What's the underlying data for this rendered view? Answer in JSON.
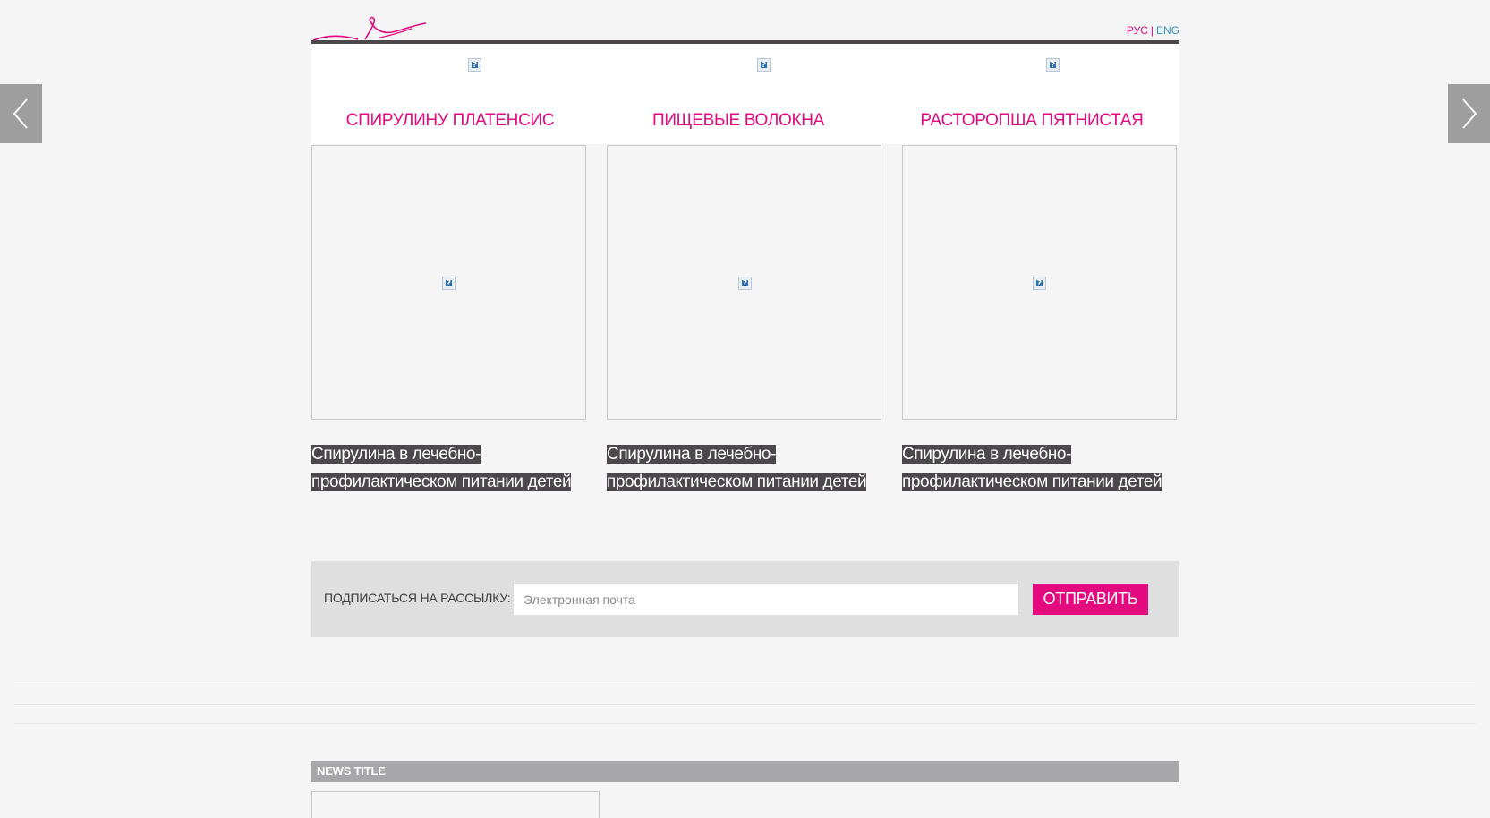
{
  "header": {
    "lang_ru": "РУС",
    "lang_separator": "|",
    "lang_en": "ENG",
    "accent_color": "#e5097f",
    "bar_color": "#4b474a",
    "logo_icon": "flamingo-logo-icon"
  },
  "carousel": {
    "prev_icon": "chevron-left-icon",
    "next_icon": "chevron-right-icon",
    "items": [
      {
        "title": "СПИРУЛИНУ ПЛАТЕНСИС",
        "caption": "Спирулина в лечебно-профилактическом питании детей",
        "icon_image": "broken-image-icon",
        "thumb_image": "broken-image-icon"
      },
      {
        "title": "ПИЩЕВЫЕ ВОЛОКНА",
        "caption": "Спирулина в лечебно-профилактическом питании детей",
        "icon_image": "broken-image-icon",
        "thumb_image": "broken-image-icon"
      },
      {
        "title": "РАСТОРОПША ПЯТНИСТАЯ",
        "caption": "Спирулина в лечебно-профилактическом питании детей",
        "icon_image": "broken-image-icon",
        "thumb_image": "broken-image-icon"
      }
    ]
  },
  "subscribe": {
    "label": "ПОДПИСАТЬСЯ НА РАССЫЛКУ:",
    "email_placeholder": "Электронная почта",
    "email_value": "",
    "submit_label": "ОТПРАВИТЬ"
  },
  "news": {
    "title": "NEWS TITLE"
  }
}
